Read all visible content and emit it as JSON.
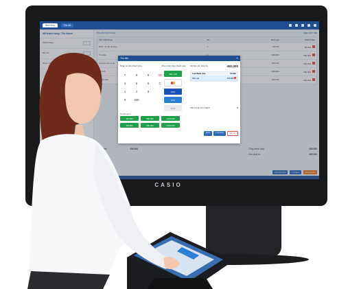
{
  "device": {
    "brand": "CASIO"
  },
  "app": {
    "tabs": [
      "Bán hàng",
      "Thu chi"
    ],
    "active_tab_index": 0
  },
  "sidebar": {
    "title": "Mã khách hàng / Tên khách",
    "rows": [
      "Khách hàng",
      "Bàn ăn",
      "Nhóm KH"
    ]
  },
  "main": {
    "breadcrumb": "Hóa đơn bán hàng",
    "breadcrumb_right": "Ngày hôm nay",
    "columns": [
      "Tên mặt hàng",
      "SL",
      "Đơn giá",
      "Thành tiền"
    ],
    "rows": [
      {
        "name": "Bánh mì thịt nướng",
        "qty": "1",
        "price": "50.000",
        "total": "50.000"
      },
      {
        "name": "Trà sữa",
        "qty": "1",
        "price": "100.000",
        "total": "100.000"
      },
      {
        "name": "Cà phê sữa nóng",
        "qty": "1",
        "price": "100.000",
        "total": "100.000"
      },
      {
        "name": "Sinh tố",
        "qty": "1",
        "price": "100.000",
        "total": "100.000"
      },
      {
        "name": "Nước cam",
        "qty": "1",
        "price": "100.000",
        "total": "100.000"
      }
    ],
    "totals_left": {
      "label": "Thành tiền",
      "value": "452.000"
    },
    "totals_right": [
      {
        "label": "Tổng thanh toán",
        "value": "452.000"
      },
      {
        "label": "Còn phải trả",
        "value": "452.000"
      }
    ],
    "bottom_buttons": [
      "Hủy hóa đơn",
      "Lưu tạm",
      "Thanh toán"
    ]
  },
  "dialog": {
    "title": "Thu tiền",
    "pad_left": "Nhập số tiền khách đưa",
    "pad_right": "Chọn hình thức thanh toán",
    "keys": [
      "7",
      "8",
      "9",
      "⌫",
      "4",
      "5",
      "6",
      "C",
      "1",
      "2",
      "3",
      "",
      "0",
      "000",
      "",
      ""
    ],
    "cards": [
      "Tiền mặt",
      "MasterCard",
      "VISA",
      "ATM",
      "Khác"
    ],
    "quick_label": "Số tiền gợi ý",
    "quick_amounts": [
      "452.000",
      "500.000",
      "1.000.000",
      "453.000",
      "460.000",
      "2.000.000"
    ],
    "pay_title": "Số tiền cần phải trả",
    "pay_amount": "452.000",
    "pay_columns": [
      "Loại thanh toán",
      "Số tiền"
    ],
    "pay_rows": [
      {
        "type": "Tiền mặt",
        "amount": "452.000"
      }
    ],
    "change_label": "Tiền trả lại cho khách",
    "change_value": "0",
    "actions": [
      "Đóng",
      "In & Đóng",
      "Hủy bỏ"
    ]
  }
}
